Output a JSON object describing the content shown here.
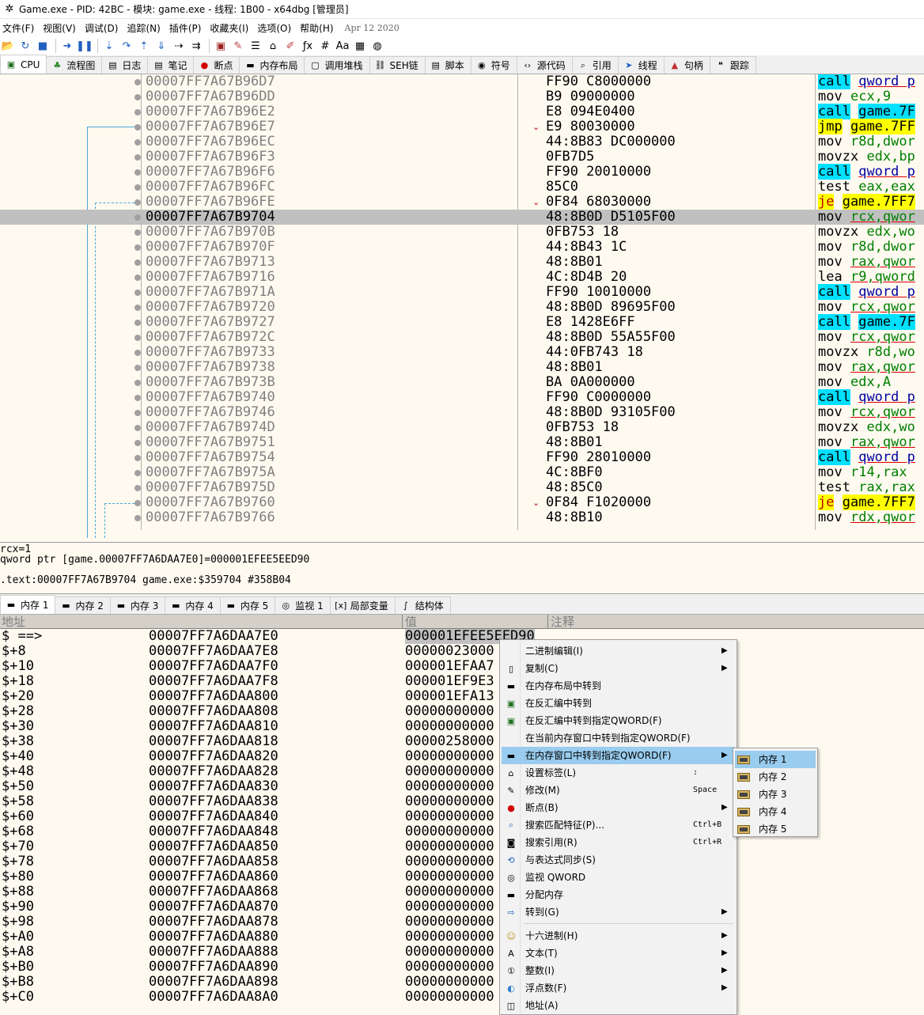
{
  "title": "Game.exe - PID: 42BC - 模块: game.exe - 线程: 1B00 - x64dbg [管理员]",
  "menu": [
    "文件(F)",
    "视图(V)",
    "调试(D)",
    "追踪(N)",
    "插件(P)",
    "收藏夹(I)",
    "选项(O)",
    "帮助(H)"
  ],
  "menu_date": "Apr 12 2020",
  "toolbar_icons": [
    "open-icon",
    "restart-icon",
    "stop-icon",
    "run-icon",
    "pause-icon",
    "step-into-icon",
    "step-over-icon",
    "step-out-icon",
    "run-to-user-icon",
    "trace-into-icon",
    "trace-over-icon",
    "scylla-icon",
    "patch-icon",
    "comment-icon",
    "label-icon",
    "bookmark-icon",
    "function-icon",
    "hash-icon",
    "font-icon",
    "calculator-icon",
    "globe-icon"
  ],
  "top_tabs": [
    {
      "label": "CPU",
      "icon": "cpu-icon"
    },
    {
      "label": "流程图",
      "icon": "graph-icon"
    },
    {
      "label": "日志",
      "icon": "log-icon"
    },
    {
      "label": "笔记",
      "icon": "notes-icon"
    },
    {
      "label": "断点",
      "icon": "breakpoint-icon"
    },
    {
      "label": "内存布局",
      "icon": "memory-map-icon"
    },
    {
      "label": "调用堆栈",
      "icon": "call-stack-icon"
    },
    {
      "label": "SEH链",
      "icon": "seh-icon"
    },
    {
      "label": "脚本",
      "icon": "script-icon"
    },
    {
      "label": "符号",
      "icon": "symbols-icon"
    },
    {
      "label": "源代码",
      "icon": "source-icon"
    },
    {
      "label": "引用",
      "icon": "references-icon"
    },
    {
      "label": "线程",
      "icon": "threads-icon"
    },
    {
      "label": "句柄",
      "icon": "handles-icon"
    },
    {
      "label": "跟踪",
      "icon": "trace-icon"
    }
  ],
  "disasm": [
    {
      "addr": "00007FF7A67B96D7",
      "bytes": "FF90 C8000000",
      "mn": "call",
      "op": "qword p",
      "kind": "call",
      "opc": "blue"
    },
    {
      "addr": "00007FF7A67B96DD",
      "bytes": "B9 09000000",
      "mn": "mov",
      "op": "ecx,9",
      "kind": "",
      "opc": "green"
    },
    {
      "addr": "00007FF7A67B96E2",
      "bytes": "E8 094E0400",
      "mn": "call",
      "op": "game.7F",
      "kind": "call",
      "opc": ""
    },
    {
      "addr": "00007FF7A67B96E7",
      "bytes": "E9 80030000",
      "mn": "jmp",
      "op": "game.7FF",
      "kind": "jmp",
      "opc": "",
      "mark": "⌄"
    },
    {
      "addr": "00007FF7A67B96EC",
      "bytes": "44:8B83 DC000000",
      "mn": "mov",
      "op": "r8d,dwor",
      "kind": "",
      "opc": "green"
    },
    {
      "addr": "00007FF7A67B96F3",
      "bytes": "0FB7D5",
      "mn": "movzx",
      "op": "edx,bp",
      "kind": "",
      "opc": "green"
    },
    {
      "addr": "00007FF7A67B96F6",
      "bytes": "FF90 20010000",
      "mn": "call",
      "op": "qword p",
      "kind": "call",
      "opc": "blue"
    },
    {
      "addr": "00007FF7A67B96FC",
      "bytes": "85C0",
      "mn": "test",
      "op": "eax,eax",
      "kind": "",
      "opc": "green"
    },
    {
      "addr": "00007FF7A67B96FE",
      "bytes": "0F84 68030000",
      "mn": "je",
      "op": "game.7FF7",
      "kind": "je",
      "opc": "",
      "mark": "⌄"
    },
    {
      "addr": "00007FF7A67B9704",
      "bytes": "48:8B0D D5105F00",
      "mn": "mov",
      "op": "rcx,qwor",
      "kind": "",
      "opc": "mix",
      "sel": true
    },
    {
      "addr": "00007FF7A67B970B",
      "bytes": "0FB753 18",
      "mn": "movzx",
      "op": "edx,wo",
      "kind": "",
      "opc": "green"
    },
    {
      "addr": "00007FF7A67B970F",
      "bytes": "44:8B43 1C",
      "mn": "mov",
      "op": "r8d,dwor",
      "kind": "",
      "opc": "green"
    },
    {
      "addr": "00007FF7A67B9713",
      "bytes": "48:8B01",
      "mn": "mov",
      "op": "rax,qwor",
      "kind": "",
      "opc": "mix"
    },
    {
      "addr": "00007FF7A67B9716",
      "bytes": "4C:8D4B 20",
      "mn": "lea",
      "op": "r9,qword",
      "kind": "",
      "opc": "mix"
    },
    {
      "addr": "00007FF7A67B971A",
      "bytes": "FF90 10010000",
      "mn": "call",
      "op": "qword p",
      "kind": "call",
      "opc": "blue"
    },
    {
      "addr": "00007FF7A67B9720",
      "bytes": "48:8B0D 89695F00",
      "mn": "mov",
      "op": "rcx,qwor",
      "kind": "",
      "opc": "mix"
    },
    {
      "addr": "00007FF7A67B9727",
      "bytes": "E8 1428E6FF",
      "mn": "call",
      "op": "game.7F",
      "kind": "call",
      "opc": ""
    },
    {
      "addr": "00007FF7A67B972C",
      "bytes": "48:8B0D 55A55F00",
      "mn": "mov",
      "op": "rcx,qwor",
      "kind": "",
      "opc": "mix"
    },
    {
      "addr": "00007FF7A67B9733",
      "bytes": "44:0FB743 18",
      "mn": "movzx",
      "op": "r8d,wo",
      "kind": "",
      "opc": "green"
    },
    {
      "addr": "00007FF7A67B9738",
      "bytes": "48:8B01",
      "mn": "mov",
      "op": "rax,qwor",
      "kind": "",
      "opc": "mix"
    },
    {
      "addr": "00007FF7A67B973B",
      "bytes": "BA 0A000000",
      "mn": "mov",
      "op": "edx,A",
      "kind": "",
      "opc": "green"
    },
    {
      "addr": "00007FF7A67B9740",
      "bytes": "FF90 C0000000",
      "mn": "call",
      "op": "qword p",
      "kind": "call",
      "opc": "blue"
    },
    {
      "addr": "00007FF7A67B9746",
      "bytes": "48:8B0D 93105F00",
      "mn": "mov",
      "op": "rcx,qwor",
      "kind": "",
      "opc": "mix"
    },
    {
      "addr": "00007FF7A67B974D",
      "bytes": "0FB753 18",
      "mn": "movzx",
      "op": "edx,wo",
      "kind": "",
      "opc": "green"
    },
    {
      "addr": "00007FF7A67B9751",
      "bytes": "48:8B01",
      "mn": "mov",
      "op": "rax,qwor",
      "kind": "",
      "opc": "mix"
    },
    {
      "addr": "00007FF7A67B9754",
      "bytes": "FF90 28010000",
      "mn": "call",
      "op": "qword p",
      "kind": "call",
      "opc": "blue"
    },
    {
      "addr": "00007FF7A67B975A",
      "bytes": "4C:8BF0",
      "mn": "mov",
      "op": "r14,rax",
      "kind": "",
      "opc": "green"
    },
    {
      "addr": "00007FF7A67B975D",
      "bytes": "48:85C0",
      "mn": "test",
      "op": "rax,rax",
      "kind": "",
      "opc": "green"
    },
    {
      "addr": "00007FF7A67B9760",
      "bytes": "0F84 F1020000",
      "mn": "je",
      "op": "game.7FF7",
      "kind": "je",
      "opc": "",
      "mark": "⌄"
    },
    {
      "addr": "00007FF7A67B9766",
      "bytes": "48:8B10",
      "mn": "mov",
      "op": "rdx,qwor",
      "kind": "",
      "opc": "mix"
    }
  ],
  "info": {
    "line1": "rcx=1",
    "line2": "qword ptr [game.00007FF7A6DAA7E0]=000001EFEE5EED90",
    "line3": ".text:00007FF7A67B9704 game.exe:$359704 #358B04"
  },
  "bottom_tabs": [
    {
      "label": "内存 1",
      "icon": "memory-icon"
    },
    {
      "label": "内存 2",
      "icon": "memory-icon"
    },
    {
      "label": "内存 3",
      "icon": "memory-icon"
    },
    {
      "label": "内存 4",
      "icon": "memory-icon"
    },
    {
      "label": "内存 5",
      "icon": "memory-icon"
    },
    {
      "label": "监视 1",
      "icon": "watch-icon"
    },
    {
      "label": "局部变量",
      "icon": "locals-icon"
    },
    {
      "label": "结构体",
      "icon": "struct-icon"
    }
  ],
  "dump_headers": {
    "addr": "地址",
    "val": "值",
    "comment": "注释"
  },
  "dump": [
    {
      "off": "$ ==>",
      "addr": "00007FF7A6DAA7E0",
      "val": "000001EFEE5EED90"
    },
    {
      "off": "$+8",
      "addr": "00007FF7A6DAA7E8",
      "val": "00000023000"
    },
    {
      "off": "$+10",
      "addr": "00007FF7A6DAA7F0",
      "val": "000001EFAA7"
    },
    {
      "off": "$+18",
      "addr": "00007FF7A6DAA7F8",
      "val": "000001EF9E3"
    },
    {
      "off": "$+20",
      "addr": "00007FF7A6DAA800",
      "val": "000001EFA13"
    },
    {
      "off": "$+28",
      "addr": "00007FF7A6DAA808",
      "val": "00000000000"
    },
    {
      "off": "$+30",
      "addr": "00007FF7A6DAA810",
      "val": "00000000000"
    },
    {
      "off": "$+38",
      "addr": "00007FF7A6DAA818",
      "val": "00000258000"
    },
    {
      "off": "$+40",
      "addr": "00007FF7A6DAA820",
      "val": "00000000000"
    },
    {
      "off": "$+48",
      "addr": "00007FF7A6DAA828",
      "val": "00000000000"
    },
    {
      "off": "$+50",
      "addr": "00007FF7A6DAA830",
      "val": "00000000000"
    },
    {
      "off": "$+58",
      "addr": "00007FF7A6DAA838",
      "val": "00000000000"
    },
    {
      "off": "$+60",
      "addr": "00007FF7A6DAA840",
      "val": "00000000000"
    },
    {
      "off": "$+68",
      "addr": "00007FF7A6DAA848",
      "val": "00000000000"
    },
    {
      "off": "$+70",
      "addr": "00007FF7A6DAA850",
      "val": "00000000000"
    },
    {
      "off": "$+78",
      "addr": "00007FF7A6DAA858",
      "val": "00000000000"
    },
    {
      "off": "$+80",
      "addr": "00007FF7A6DAA860",
      "val": "00000000000"
    },
    {
      "off": "$+88",
      "addr": "00007FF7A6DAA868",
      "val": "00000000000"
    },
    {
      "off": "$+90",
      "addr": "00007FF7A6DAA870",
      "val": "00000000000"
    },
    {
      "off": "$+98",
      "addr": "00007FF7A6DAA878",
      "val": "00000000000"
    },
    {
      "off": "$+A0",
      "addr": "00007FF7A6DAA880",
      "val": "00000000000"
    },
    {
      "off": "$+A8",
      "addr": "00007FF7A6DAA888",
      "val": "00000000000"
    },
    {
      "off": "$+B0",
      "addr": "00007FF7A6DAA890",
      "val": "00000000000"
    },
    {
      "off": "$+B8",
      "addr": "00007FF7A6DAA898",
      "val": "00000000000"
    },
    {
      "off": "$+C0",
      "addr": "00007FF7A6DAA8A0",
      "val": "00000000000"
    }
  ],
  "context_menu": [
    {
      "label": "二进制编辑(I)",
      "icon": "",
      "arrow": true
    },
    {
      "label": "复制(C)",
      "icon": "copy-icon",
      "arrow": true
    },
    {
      "label": "在内存布局中转到",
      "icon": "memory-map-icon"
    },
    {
      "label": "在反汇编中转到",
      "icon": "cpu-icon"
    },
    {
      "label": "在反汇编中转到指定QWORD(F)",
      "icon": "cpu-icon"
    },
    {
      "label": "在当前内存窗口中转到指定QWORD(F)",
      "icon": ""
    },
    {
      "label": "在内存窗口中转到指定QWORD(F)",
      "icon": "memory-icon",
      "arrow": true,
      "hover": true
    },
    {
      "label": "设置标签(L)",
      "icon": "label-icon",
      "shortcut": ":"
    },
    {
      "label": "修改(M)",
      "icon": "pencil-icon",
      "shortcut": "Space"
    },
    {
      "label": "断点(B)",
      "icon": "breakpoint-icon",
      "arrow": true
    },
    {
      "label": "搜索匹配特征(P)...",
      "icon": "search-icon",
      "shortcut": "Ctrl+B"
    },
    {
      "label": "搜索引用(R)",
      "icon": "binoculars-icon",
      "shortcut": "Ctrl+R"
    },
    {
      "label": "与表达式同步(S)",
      "icon": "sync-icon"
    },
    {
      "label": "监视 QWORD",
      "icon": "watch-icon"
    },
    {
      "label": "分配内存",
      "icon": "memory-alloc-icon"
    },
    {
      "label": "转到(G)",
      "icon": "goto-icon",
      "arrow": true,
      "sep_after": true
    },
    {
      "label": "十六进制(H)",
      "icon": "hex-icon",
      "arrow": true
    },
    {
      "label": "文本(T)",
      "icon": "text-icon",
      "arrow": true
    },
    {
      "label": "整数(I)",
      "icon": "integer-icon",
      "arrow": true
    },
    {
      "label": "浮点数(F)",
      "icon": "float-icon",
      "arrow": true
    },
    {
      "label": "地址(A)",
      "icon": "address-icon"
    }
  ],
  "submenu": [
    {
      "label": "内存 1",
      "hover": true
    },
    {
      "label": "内存 2"
    },
    {
      "label": "内存 3"
    },
    {
      "label": "内存 4"
    },
    {
      "label": "内存 5"
    }
  ],
  "colors": {
    "call_bg": "#00e0ff",
    "jmp_bg": "#ffff00",
    "selection": "#c0c0c0",
    "menu_hover": "#99ccee",
    "pane_bg": "#fffaf0"
  }
}
